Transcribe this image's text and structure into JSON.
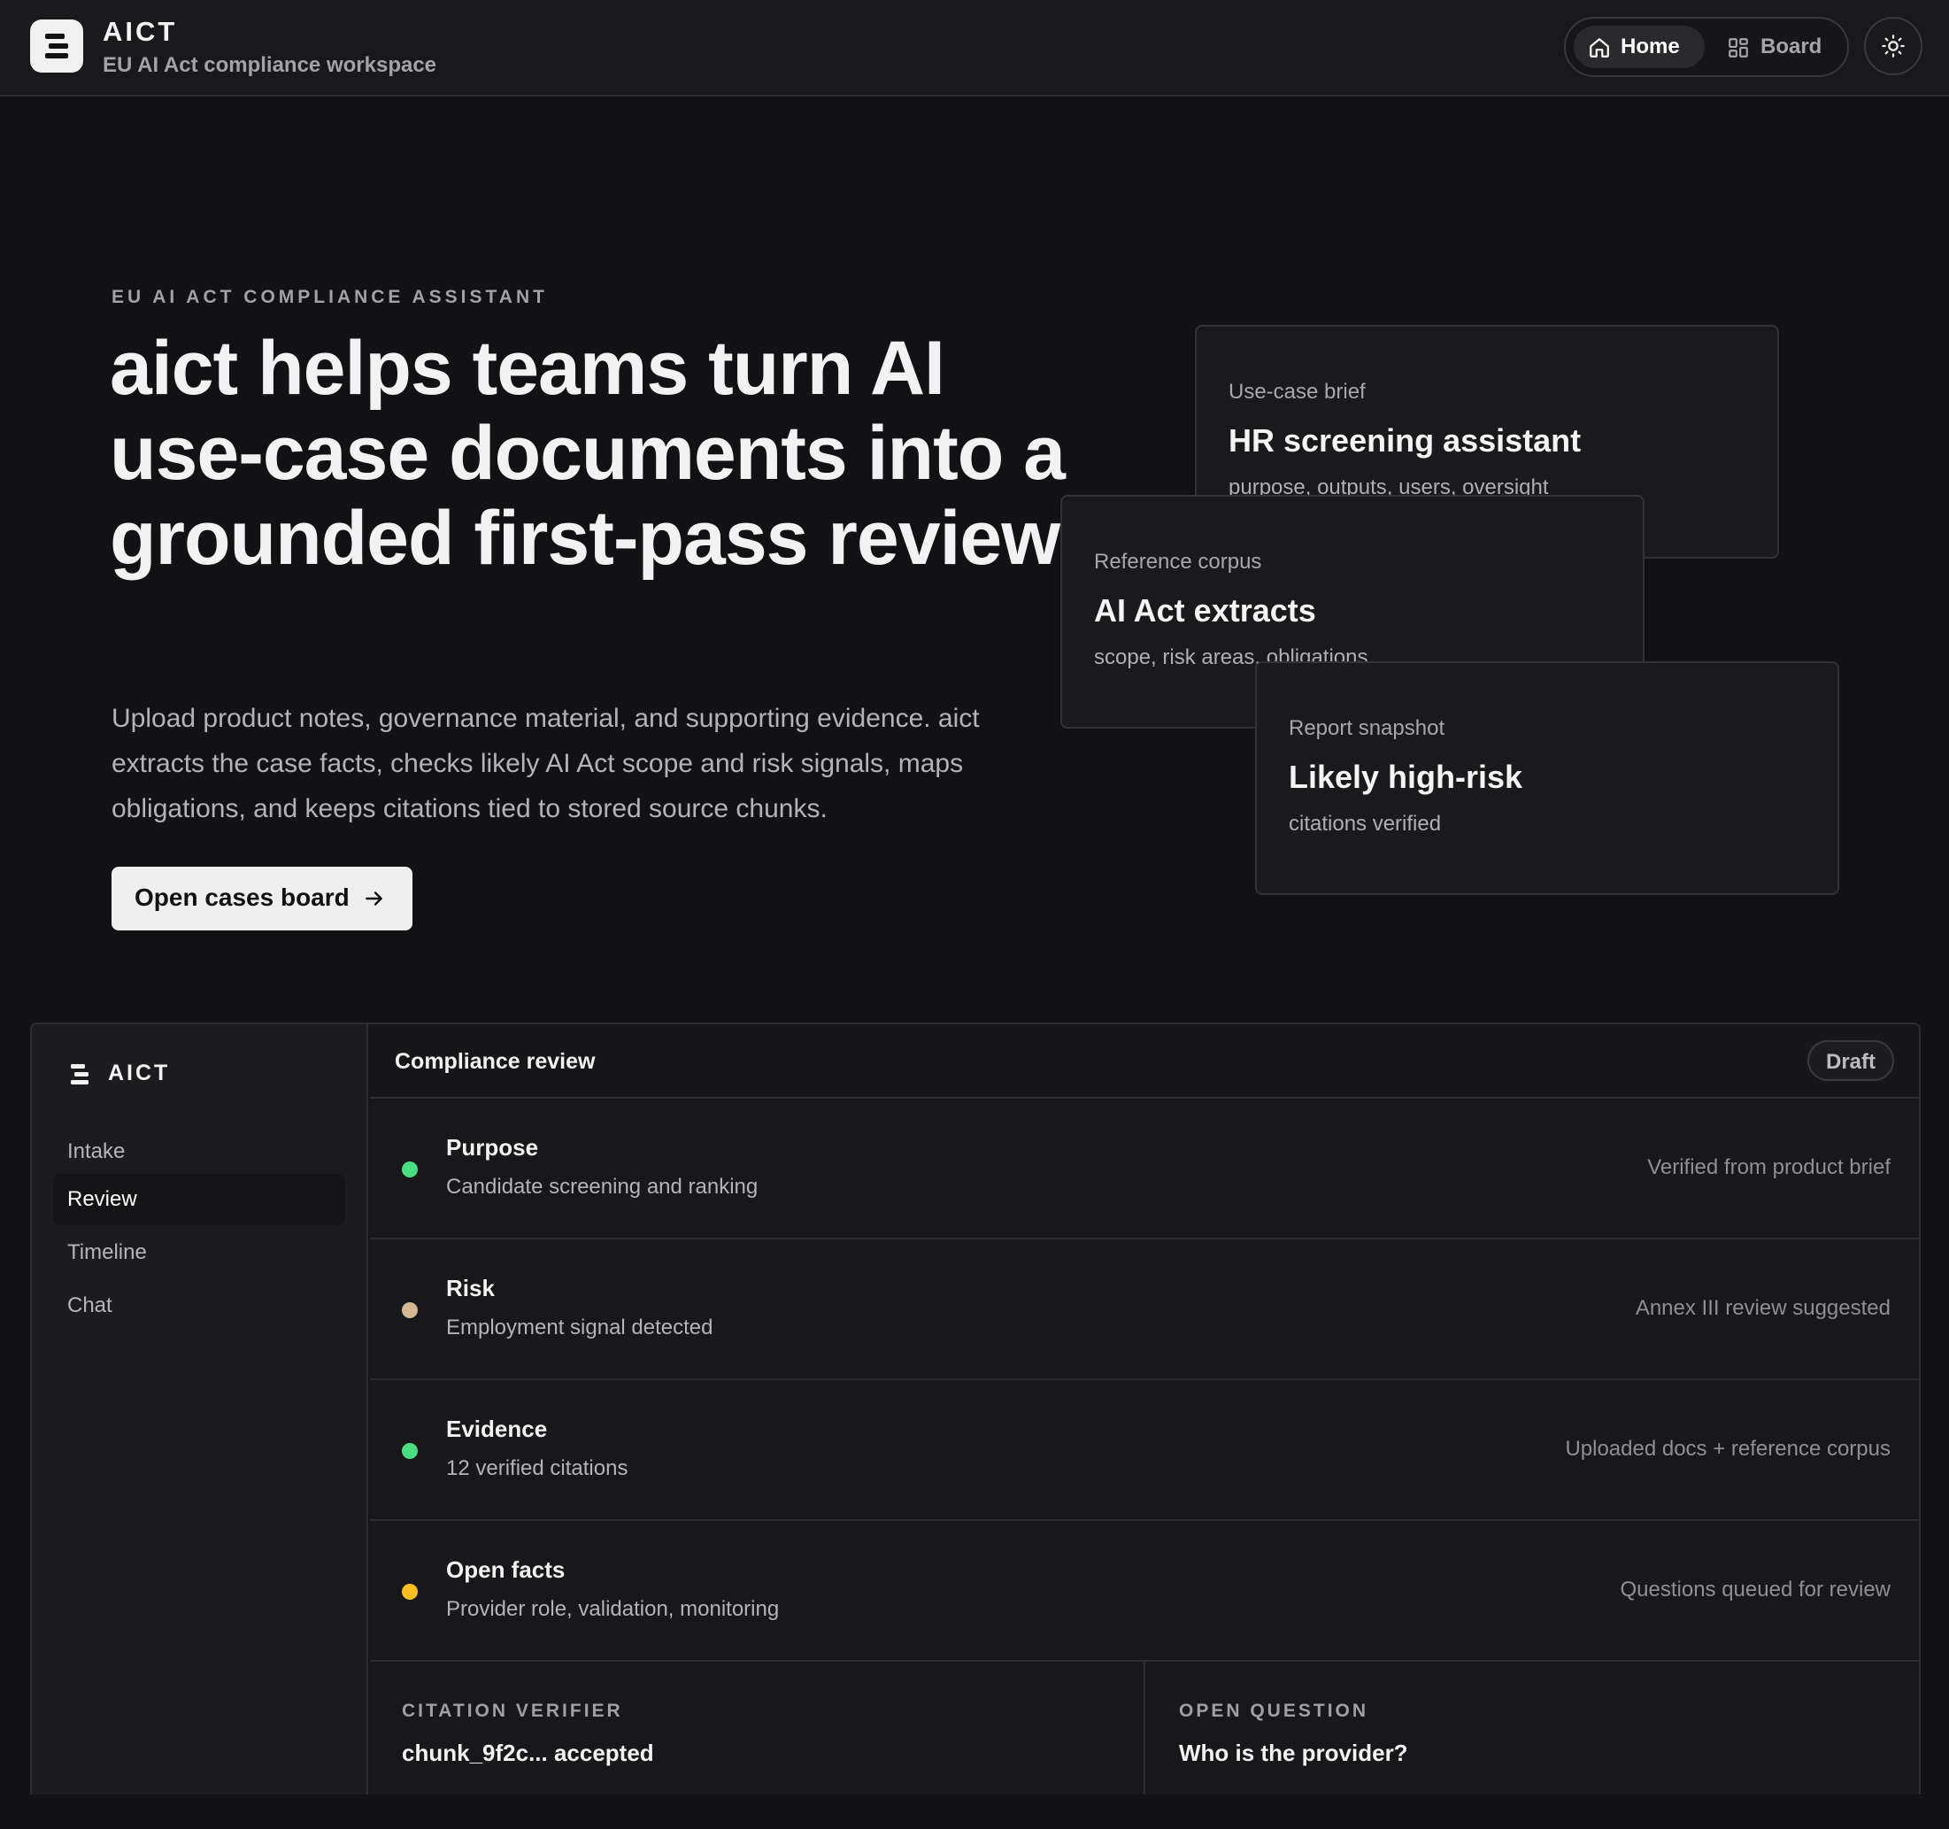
{
  "app": {
    "name": "AICT",
    "subtitle": "EU AI Act compliance workspace"
  },
  "nav": {
    "home_label": "Home",
    "board_label": "Board",
    "active": "Home"
  },
  "hero": {
    "eyebrow": "EU AI ACT COMPLIANCE ASSISTANT",
    "title": "aict helps teams turn AI use-case documents into a grounded first-pass review.",
    "description": "Upload product notes, governance material, and supporting evidence. aict extracts the case facts, checks likely AI Act scope and risk signals, maps obligations, and keeps citations tied to stored source chunks.",
    "cta_label": "Open cases board"
  },
  "cards": [
    {
      "label": "Use-case brief",
      "title": "HR screening assistant",
      "meta": "purpose, outputs, users, oversight"
    },
    {
      "label": "Reference corpus",
      "title": "AI Act extracts",
      "meta": "scope, risk areas, obligations"
    },
    {
      "label": "Report snapshot",
      "title": "Likely high-risk",
      "meta": "citations verified"
    }
  ],
  "preview": {
    "brand": "AICT",
    "sidebar_items": [
      {
        "label": "Intake"
      },
      {
        "label": "Review"
      },
      {
        "label": "Timeline"
      },
      {
        "label": "Chat"
      }
    ],
    "active_item": "Review",
    "header_title": "Compliance review",
    "status_badge": "Draft",
    "rows": [
      {
        "title": "Purpose",
        "subtitle": "Candidate screening and ranking",
        "note": "Verified from product brief",
        "status_color": "#4ade80"
      },
      {
        "title": "Risk",
        "subtitle": "Employment signal detected",
        "note": "Annex III review suggested",
        "status_color": "#d4b896"
      },
      {
        "title": "Evidence",
        "subtitle": "12 verified citations",
        "note": "Uploaded docs + reference corpus",
        "status_color": "#4ade80"
      },
      {
        "title": "Open facts",
        "subtitle": "Provider role, validation, monitoring",
        "note": "Questions queued for review",
        "status_color": "#fbbf24"
      }
    ],
    "citation_verifier": {
      "label": "CITATION VERIFIER",
      "value": "chunk_9f2c... accepted"
    },
    "open_question": {
      "label": "OPEN QUESTION",
      "value": "Who is the provider?"
    }
  },
  "colors": {
    "background": "#121214",
    "surface": "#1a1a1c",
    "border": "#2e2e32",
    "accent_light": "#efefef"
  }
}
